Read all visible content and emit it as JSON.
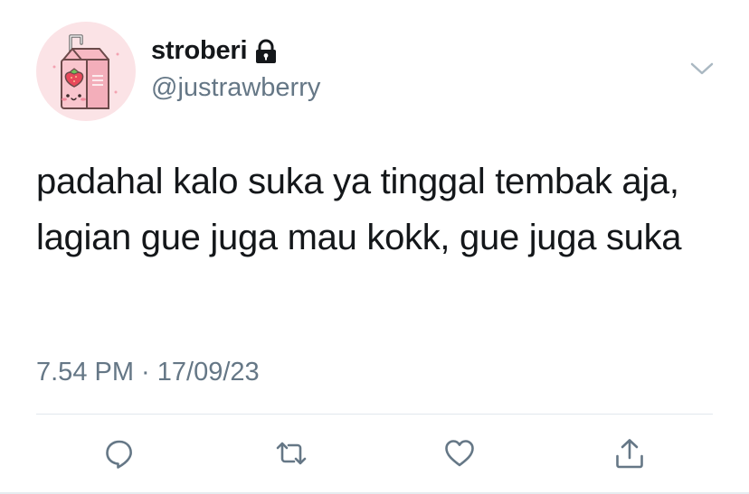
{
  "user": {
    "display_name": "stroberi",
    "handle": "@justrawberry",
    "protected": true,
    "avatar": "strawberry-milk-carton-icon"
  },
  "tweet": {
    "text": "padahal kalo suka ya tinggal tembak aja, lagian gue juga mau kokk, gue juga suka",
    "timestamp": "7.54 PM · 17/09/23"
  },
  "actions": [
    {
      "name": "reply",
      "icon": "speech-bubble-icon"
    },
    {
      "name": "retweet",
      "icon": "retweet-icon"
    },
    {
      "name": "like",
      "icon": "heart-icon"
    },
    {
      "name": "share",
      "icon": "share-icon"
    }
  ],
  "colors": {
    "text": "#14171a",
    "secondary": "#657786",
    "avatar_bg": "#fbe3e6",
    "divider": "#e1e8ed"
  }
}
